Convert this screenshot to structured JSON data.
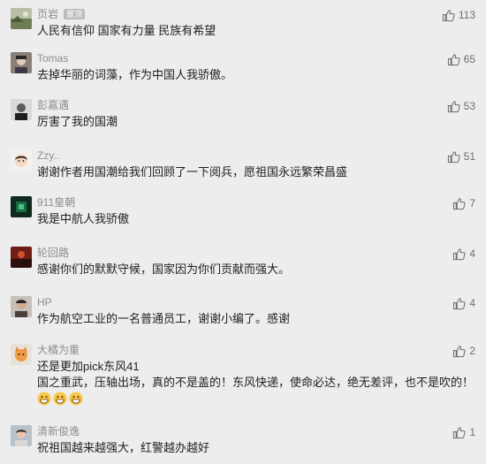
{
  "colors": {
    "background": "#ededed",
    "name": "#8d8d8d",
    "text": "#1f1f1f",
    "like": "#6e6e6e",
    "badge": "#bcbcbc"
  },
  "comments": [
    {
      "name": "页岩",
      "badge": "置顶",
      "text": "人民有信仰  国家有力量  民族有希望",
      "likes": "113",
      "avatar_icon": "landscape-avatar-icon"
    },
    {
      "name": "Tomas",
      "text": "去掉华丽的词藻，作为中国人我骄傲。",
      "likes": "65",
      "avatar_icon": "portrait-avatar-icon"
    },
    {
      "name": "彭嘉遇",
      "text": "厉害了我的国潮",
      "likes": "53",
      "avatar_icon": "portrait-avatar-icon"
    },
    {
      "name": "Zzy..",
      "text": "谢谢作者用国潮给我们回顾了一下阅兵，愿祖国永远繁荣昌盛",
      "likes": "51",
      "avatar_icon": "cartoon-avatar-icon"
    },
    {
      "name": "911皇朝",
      "text": "我是中航人我骄傲",
      "likes": "7",
      "avatar_icon": "dark-emblem-avatar-icon"
    },
    {
      "name": "轮回路",
      "text": "感谢你们的默默守候，国家因为你们贡献而强大。",
      "likes": "4",
      "avatar_icon": "red-landscape-avatar-icon"
    },
    {
      "name": "HP",
      "text": "作为航空工业的一名普通员工，谢谢小编了。感谢",
      "likes": "4",
      "avatar_icon": "portrait-avatar-icon"
    },
    {
      "name": "大橘为重",
      "text_line1": "还是更加pick东风41",
      "text_line2": "国之重武，压轴出场，真的不是盖的！东风快递，使命必达，绝无差评，也不是吹的！",
      "emoji_count": 3,
      "likes": "2",
      "avatar_icon": "cat-avatar-icon"
    },
    {
      "name": "清新俊逸",
      "text": "祝祖国越来越强大，红警越办越好",
      "likes": "1",
      "avatar_icon": "portrait-avatar-icon"
    }
  ]
}
